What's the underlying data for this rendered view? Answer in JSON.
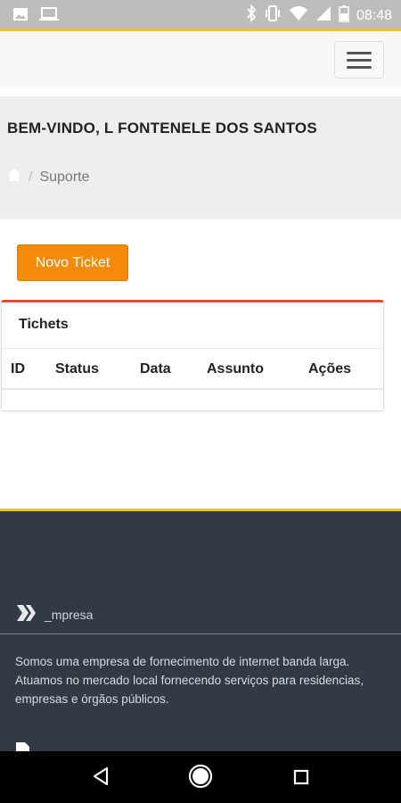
{
  "status_bar": {
    "time": "08:48",
    "icons": [
      "image-icon",
      "laptop-icon",
      "bluetooth-icon",
      "vibrate-icon",
      "wifi-icon",
      "signal-icon",
      "battery-icon"
    ]
  },
  "header": {
    "welcome": "BEM-VINDO, L FONTENELE DOS SANTOS",
    "breadcrumb": {
      "home_icon": "home-icon",
      "current": "Suporte"
    }
  },
  "actions": {
    "new_ticket": "Novo Ticket"
  },
  "tickets_box": {
    "title": "Tichets",
    "columns": [
      "ID",
      "Status",
      "Data",
      "Assunto",
      "Ações"
    ],
    "rows": []
  },
  "footer": {
    "brand": "_mpresa",
    "about": "Somos uma empresa de fornecimento de internet banda larga. Atuamos no mercado local fornecendo serviços para residencias, empresas e órgãos públicos."
  },
  "colors": {
    "accent": "#f58a07",
    "top_border": "#f0c030",
    "box_border": "#dd4b39",
    "footer_bg": "#333a46"
  }
}
